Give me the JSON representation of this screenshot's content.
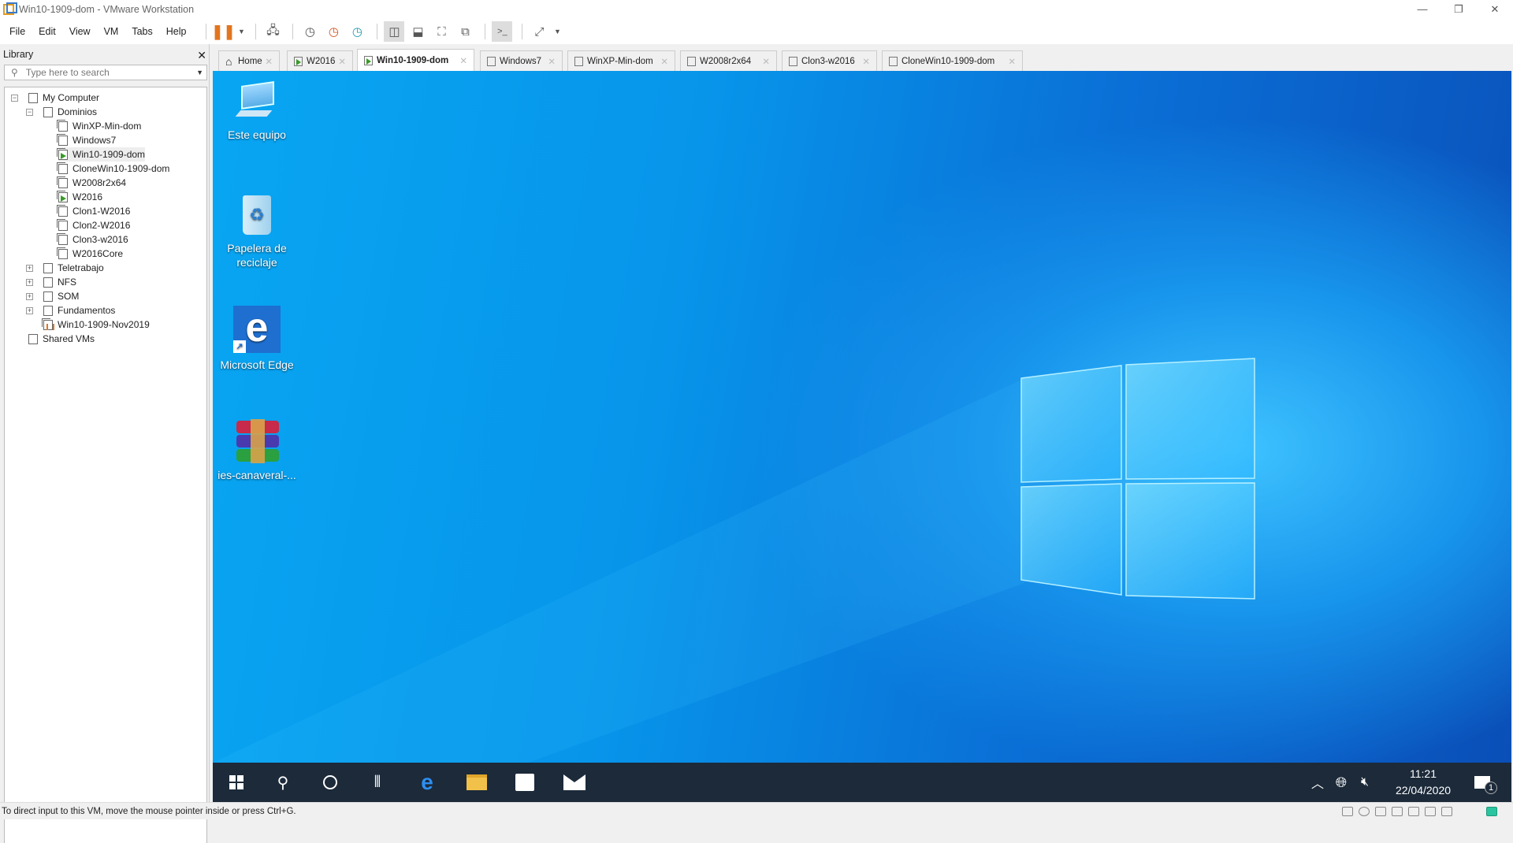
{
  "window": {
    "title": "Win10-1909-dom - VMware Workstation"
  },
  "menu": [
    "File",
    "Edit",
    "View",
    "VM",
    "Tabs",
    "Help"
  ],
  "library": {
    "title": "Library",
    "search_placeholder": "Type here to search",
    "tree": [
      {
        "label": "My Computer",
        "level": 0,
        "expander": "−",
        "icon": "computer"
      },
      {
        "label": "Dominios",
        "level": 1,
        "expander": "−",
        "icon": "folder"
      },
      {
        "label": "WinXP-Min-dom",
        "level": 2,
        "icon": "vm"
      },
      {
        "label": "Windows7",
        "level": 2,
        "icon": "vm"
      },
      {
        "label": "Win10-1909-dom",
        "level": 2,
        "icon": "vm-running",
        "selected": true
      },
      {
        "label": "CloneWin10-1909-dom",
        "level": 2,
        "icon": "vm-clone"
      },
      {
        "label": "W2008r2x64",
        "level": 2,
        "icon": "vm"
      },
      {
        "label": "W2016",
        "level": 2,
        "icon": "vm-running"
      },
      {
        "label": "Clon1-W2016",
        "level": 2,
        "icon": "vm-clone"
      },
      {
        "label": "Clon2-W2016",
        "level": 2,
        "icon": "vm-clone"
      },
      {
        "label": "Clon3-w2016",
        "level": 2,
        "icon": "vm-clone"
      },
      {
        "label": "W2016Core",
        "level": 2,
        "icon": "vm"
      },
      {
        "label": "Teletrabajo",
        "level": 1,
        "expander": "+",
        "icon": "folder"
      },
      {
        "label": "NFS",
        "level": 1,
        "expander": "+",
        "icon": "folder"
      },
      {
        "label": "SOM",
        "level": 1,
        "expander": "+",
        "icon": "folder"
      },
      {
        "label": "Fundamentos",
        "level": 1,
        "expander": "+",
        "icon": "folder"
      },
      {
        "label": "Win10-1909-Nov2019",
        "level": 1,
        "icon": "vm-paused"
      },
      {
        "label": "Shared VMs",
        "level": 0,
        "icon": "shared"
      }
    ]
  },
  "tabs": [
    {
      "label": "Home",
      "icon": "home"
    },
    {
      "label": "W2016",
      "icon": "vm-running"
    },
    {
      "label": "Win10-1909-dom",
      "icon": "vm-running",
      "active": true
    },
    {
      "label": "Windows7",
      "icon": "vm"
    },
    {
      "label": "WinXP-Min-dom",
      "icon": "vm"
    },
    {
      "label": "W2008r2x64",
      "icon": "vm"
    },
    {
      "label": "Clon3-w2016",
      "icon": "vm-clone"
    },
    {
      "label": "CloneWin10-1909-dom",
      "icon": "vm-clone"
    }
  ],
  "desktop": {
    "icons": [
      {
        "label": "Este equipo",
        "icon": "computer"
      },
      {
        "label": "Papelera de reciclaje",
        "icon": "recycle-bin"
      },
      {
        "label": "Microsoft Edge",
        "icon": "edge"
      },
      {
        "label": "ies-canaveral-...",
        "icon": "winrar-archive"
      }
    ]
  },
  "taskbar": {
    "time": "11:21",
    "date": "22/04/2020",
    "notifications": "1"
  },
  "status": {
    "text": "To direct input to this VM, move the mouse pointer inside or press Ctrl+G."
  },
  "colors": {
    "accent": "#e2751e",
    "desktop": "#0795ea",
    "taskbar": "#1c2a3a"
  }
}
